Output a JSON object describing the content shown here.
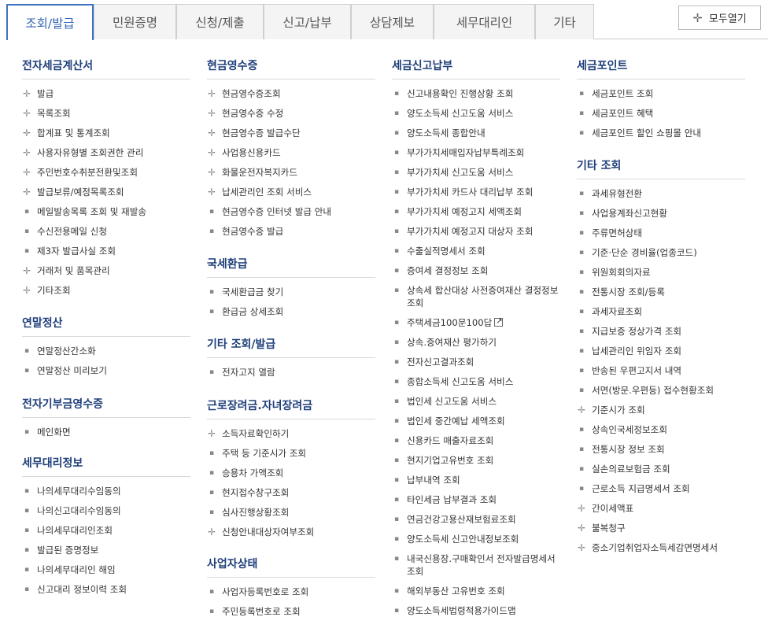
{
  "tabs": [
    "조회/발급",
    "민원증명",
    "신청/제출",
    "신고/납부",
    "상담제보",
    "세무대리인",
    "기타"
  ],
  "expand_button": "모두열기",
  "columns": [
    {
      "sections": [
        {
          "title": "전자세금계산서",
          "items": [
            {
              "label": "발급",
              "m": "plus"
            },
            {
              "label": "목록조회",
              "m": "plus"
            },
            {
              "label": "합계표 및 통계조회",
              "m": "plus"
            },
            {
              "label": "사용자유형별 조회권한 관리",
              "m": "plus"
            },
            {
              "label": "주민번호수취분전환및조회",
              "m": "plus"
            },
            {
              "label": "발급보류/예정목록조회",
              "m": "plus"
            },
            {
              "label": "메일발송목록 조회 및 재발송",
              "m": "dot"
            },
            {
              "label": "수신전용메일 신청",
              "m": "dot"
            },
            {
              "label": "제3자 발급사실 조회",
              "m": "dot"
            },
            {
              "label": "거래처 및 품목관리",
              "m": "plus"
            },
            {
              "label": "기타조회",
              "m": "plus"
            }
          ]
        },
        {
          "title": "연말정산",
          "items": [
            {
              "label": "연말정산간소화",
              "m": "dot"
            },
            {
              "label": "연말정산 미리보기",
              "m": "dot"
            }
          ]
        },
        {
          "title": "전자기부금영수증",
          "items": [
            {
              "label": "메인화면",
              "m": "dot"
            }
          ]
        },
        {
          "title": "세무대리정보",
          "items": [
            {
              "label": "나의세무대리수임동의",
              "m": "dot"
            },
            {
              "label": "나의신고대리수임동의",
              "m": "dot"
            },
            {
              "label": "나의세무대리인조회",
              "m": "dot"
            },
            {
              "label": "발급된 증명정보",
              "m": "dot"
            },
            {
              "label": "나의세무대리인 해임",
              "m": "dot"
            },
            {
              "label": "신고대리 정보이력 조회",
              "m": "dot"
            }
          ]
        }
      ]
    },
    {
      "sections": [
        {
          "title": "현금영수증",
          "items": [
            {
              "label": "현금영수증조회",
              "m": "plus"
            },
            {
              "label": "현금영수증 수정",
              "m": "plus"
            },
            {
              "label": "현금영수증 발급수단",
              "m": "plus"
            },
            {
              "label": "사업용신용카드",
              "m": "plus"
            },
            {
              "label": "화물운전자복지카드",
              "m": "plus"
            },
            {
              "label": "납세관리인 조회 서비스",
              "m": "plus"
            },
            {
              "label": "현금영수증 인터넷 발급 안내",
              "m": "dot"
            },
            {
              "label": "현금영수증 발급",
              "m": "dot"
            }
          ]
        },
        {
          "title": "국세환급",
          "items": [
            {
              "label": "국세환급금 찾기",
              "m": "dot"
            },
            {
              "label": "환급금 상세조회",
              "m": "dot"
            }
          ]
        },
        {
          "title": "기타 조회/발급",
          "items": [
            {
              "label": "전자고지 열람",
              "m": "dot"
            }
          ]
        },
        {
          "title": "근로장려금.자녀장려금",
          "items": [
            {
              "label": "소득자료확인하기",
              "m": "plus"
            },
            {
              "label": "주택 등 기준시가 조회",
              "m": "dot"
            },
            {
              "label": "승용차 가액조회",
              "m": "dot"
            },
            {
              "label": "현지접수창구조회",
              "m": "dot"
            },
            {
              "label": "심사진행상황조회",
              "m": "dot"
            },
            {
              "label": "신청안내대상자여부조회",
              "m": "plus"
            }
          ]
        },
        {
          "title": "사업자상태",
          "items": [
            {
              "label": "사업자등록번호로 조회",
              "m": "dot"
            },
            {
              "label": "주민등록번호로 조회",
              "m": "dot"
            }
          ]
        }
      ]
    },
    {
      "sections": [
        {
          "title": "세금신고납부",
          "items": [
            {
              "label": "신고내용확인 진행상황 조회",
              "m": "dot"
            },
            {
              "label": "양도소득세 신고도움 서비스",
              "m": "dot"
            },
            {
              "label": "양도소득세 종합안내",
              "m": "dot"
            },
            {
              "label": "부가가치세매입자납부특례조회",
              "m": "dot"
            },
            {
              "label": "부가가치세 신고도움 서비스",
              "m": "dot"
            },
            {
              "label": "부가가치세 카드사 대리납부 조회",
              "m": "dot"
            },
            {
              "label": "부가가치세 예정고지 세액조회",
              "m": "dot"
            },
            {
              "label": "부가가치세 예정고지 대상자 조회",
              "m": "dot"
            },
            {
              "label": "수출실적명세서 조회",
              "m": "dot"
            },
            {
              "label": "증여세 결정정보 조회",
              "m": "dot"
            },
            {
              "label": "상속세 합산대상 사전증여재산 결정정보 조회",
              "m": "dot",
              "two": true
            },
            {
              "label": "주택세금100문100답",
              "m": "dot",
              "ext": true
            },
            {
              "label": "상속.증여재산 평가하기",
              "m": "dot"
            },
            {
              "label": "전자신고결과조회",
              "m": "dot"
            },
            {
              "label": "종합소득세 신고도움 서비스",
              "m": "dot"
            },
            {
              "label": "법인세 신고도움 서비스",
              "m": "dot"
            },
            {
              "label": "법인세 중간예납 세액조회",
              "m": "dot"
            },
            {
              "label": "신용카드 매출자료조회",
              "m": "dot"
            },
            {
              "label": "현지기업고유번호 조회",
              "m": "dot"
            },
            {
              "label": "납부내역 조회",
              "m": "dot"
            },
            {
              "label": "타인세금 납부결과 조회",
              "m": "dot"
            },
            {
              "label": "연금건강고용산재보험료조회",
              "m": "dot"
            },
            {
              "label": "양도소득세 신고안내정보조회",
              "m": "dot"
            },
            {
              "label": "내국신용장.구매확인서 전자발급명세서 조회",
              "m": "dot",
              "two": true
            },
            {
              "label": "해외부동산 고유번호 조회",
              "m": "dot"
            },
            {
              "label": "양도소득세법령적용가이드맵",
              "m": "dot"
            }
          ]
        }
      ]
    },
    {
      "sections": [
        {
          "title": "세금포인트",
          "items": [
            {
              "label": "세금포인트 조회",
              "m": "dot"
            },
            {
              "label": "세금포인트 혜택",
              "m": "dot"
            },
            {
              "label": "세금포인트 할인 쇼핑몰 안내",
              "m": "dot"
            }
          ]
        },
        {
          "title": "기타 조회",
          "items": [
            {
              "label": "과세유형전환",
              "m": "dot"
            },
            {
              "label": "사업용계좌신고현황",
              "m": "dot"
            },
            {
              "label": "주류면허상태",
              "m": "dot"
            },
            {
              "label": "기준·단순 경비율(업종코드)",
              "m": "dot"
            },
            {
              "label": "위원회회의자료",
              "m": "dot"
            },
            {
              "label": "전통시장 조회/등록",
              "m": "dot"
            },
            {
              "label": "과세자료조회",
              "m": "dot"
            },
            {
              "label": "지급보증 정상가격 조회",
              "m": "dot"
            },
            {
              "label": "납세관리인 위임자 조회",
              "m": "dot"
            },
            {
              "label": "반송된 우편고지서 내역",
              "m": "dot"
            },
            {
              "label": "서면(방문.우편등) 접수현황조회",
              "m": "dot"
            },
            {
              "label": "기준시가 조회",
              "m": "plus"
            },
            {
              "label": "상속인국세정보조회",
              "m": "dot"
            },
            {
              "label": "전통시장 정보 조회",
              "m": "dot"
            },
            {
              "label": "실손의료보험금 조회",
              "m": "dot"
            },
            {
              "label": "근로소득 지급명세서 조회",
              "m": "dot"
            },
            {
              "label": "간이세액표",
              "m": "plus"
            },
            {
              "label": "불복청구",
              "m": "plus"
            },
            {
              "label": "중소기업취업자소득세감면명세서",
              "m": "plus"
            }
          ]
        }
      ]
    }
  ]
}
